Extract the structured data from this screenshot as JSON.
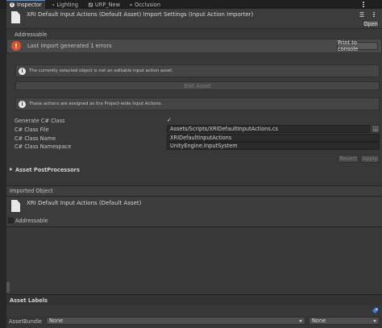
{
  "tabs": [
    {
      "label": "Inspector",
      "icon": "info-icon"
    },
    {
      "label": "Lighting",
      "icon": "bulb-icon"
    },
    {
      "label": "URP_New",
      "icon": "asset-icon"
    },
    {
      "label": "Occlusion",
      "icon": "eye-icon"
    }
  ],
  "header": {
    "title": "XRI Default Input Actions (Default Asset) Import Settings (Input Action Importer)",
    "open_label": "Open"
  },
  "addressable_label": "Addressable",
  "error": {
    "message": "Last import generated 1 errors",
    "print_label": "Print to console"
  },
  "help1": "The currently selected object is not an editable input action asset.",
  "edit_asset_label": "Edit Asset",
  "help2": "These actions are assigned as the Project-wide Input Actions.",
  "form": {
    "generate_label": "Generate C# Class",
    "generate_checked": true,
    "check_mark": "✓",
    "file_label": "C# Class File",
    "file_value": "Assets/Scripts/XRIDefaultInputActions.cs",
    "browse_label": "...",
    "name_label": "C# Class Name",
    "name_value": "XRIDefaultInputActions",
    "ns_label": "C# Class Namespace",
    "ns_value": "UnityEngine.InputSystem"
  },
  "revert_label": "Revert",
  "apply_label": "Apply",
  "postprocessors_label": "Asset PostProcessors",
  "imported": {
    "section_label": "Imported Object",
    "title": "XRI Default Input Actions (Default Asset)",
    "addressable_label": "Addressable"
  },
  "asset_labels": {
    "label": "Asset Labels",
    "bundle_label": "AssetBundle",
    "bundle_value": "None",
    "variant_value": "None"
  },
  "colors": {
    "accent": "#4a8ef0",
    "error": "#d9542b",
    "background": "#383838"
  }
}
